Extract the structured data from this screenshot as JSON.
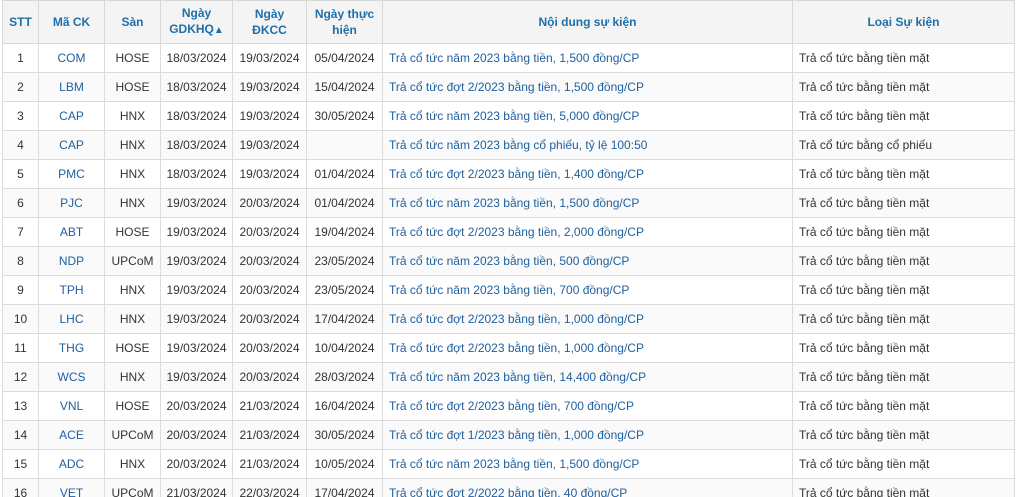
{
  "columns": {
    "stt": "STT",
    "ma_ck": "Mã CK",
    "san": "Sàn",
    "ngay_gdkhq_line1": "Ngày",
    "ngay_gdkhq_line2": "GDKHQ",
    "sort_indicator": "▲",
    "ngay_dkcc_line1": "Ngày",
    "ngay_dkcc_line2": "ĐKCC",
    "ngay_thuc_hien_line1": "Ngày thực",
    "ngay_thuc_hien_line2": "hiện",
    "noi_dung": "Nội dung sự kiện",
    "loai_su_kien": "Loại Sự kiện"
  },
  "rows": [
    {
      "stt": "1",
      "ma_ck": "COM",
      "san": "HOSE",
      "gdkhq": "18/03/2024",
      "dkcc": "19/03/2024",
      "thuc_hien": "05/04/2024",
      "noi_dung": "Trả cổ tức năm 2023 bằng tiền, 1,500 đồng/CP",
      "loai": "Trả cổ tức bằng tiền mặt"
    },
    {
      "stt": "2",
      "ma_ck": "LBM",
      "san": "HOSE",
      "gdkhq": "18/03/2024",
      "dkcc": "19/03/2024",
      "thuc_hien": "15/04/2024",
      "noi_dung": "Trả cổ tức đợt 2/2023 bằng tiền, 1,500 đồng/CP",
      "loai": "Trả cổ tức bằng tiền mặt"
    },
    {
      "stt": "3",
      "ma_ck": "CAP",
      "san": "HNX",
      "gdkhq": "18/03/2024",
      "dkcc": "19/03/2024",
      "thuc_hien": "30/05/2024",
      "noi_dung": "Trả cổ tức năm 2023 bằng tiền, 5,000 đồng/CP",
      "loai": "Trả cổ tức bằng tiền mặt"
    },
    {
      "stt": "4",
      "ma_ck": "CAP",
      "san": "HNX",
      "gdkhq": "18/03/2024",
      "dkcc": "19/03/2024",
      "thuc_hien": "",
      "noi_dung": "Trả cổ tức năm 2023 bằng cổ phiếu, tỷ lệ 100:50",
      "loai": "Trả cổ tức bằng cổ phiếu"
    },
    {
      "stt": "5",
      "ma_ck": "PMC",
      "san": "HNX",
      "gdkhq": "18/03/2024",
      "dkcc": "19/03/2024",
      "thuc_hien": "01/04/2024",
      "noi_dung": "Trả cổ tức đợt 2/2023 bằng tiền, 1,400 đồng/CP",
      "loai": "Trả cổ tức bằng tiền mặt"
    },
    {
      "stt": "6",
      "ma_ck": "PJC",
      "san": "HNX",
      "gdkhq": "19/03/2024",
      "dkcc": "20/03/2024",
      "thuc_hien": "01/04/2024",
      "noi_dung": "Trả cổ tức năm 2023 bằng tiền, 1,500 đồng/CP",
      "loai": "Trả cổ tức bằng tiền mặt"
    },
    {
      "stt": "7",
      "ma_ck": "ABT",
      "san": "HOSE",
      "gdkhq": "19/03/2024",
      "dkcc": "20/03/2024",
      "thuc_hien": "19/04/2024",
      "noi_dung": "Trả cổ tức đợt 2/2023 bằng tiền, 2,000 đồng/CP",
      "loai": "Trả cổ tức bằng tiền mặt"
    },
    {
      "stt": "8",
      "ma_ck": "NDP",
      "san": "UPCoM",
      "gdkhq": "19/03/2024",
      "dkcc": "20/03/2024",
      "thuc_hien": "23/05/2024",
      "noi_dung": "Trả cổ tức năm 2023 bằng tiền, 500 đồng/CP",
      "loai": "Trả cổ tức bằng tiền mặt"
    },
    {
      "stt": "9",
      "ma_ck": "TPH",
      "san": "HNX",
      "gdkhq": "19/03/2024",
      "dkcc": "20/03/2024",
      "thuc_hien": "23/05/2024",
      "noi_dung": "Trả cổ tức năm 2023 bằng tiền, 700 đồng/CP",
      "loai": "Trả cổ tức bằng tiền mặt"
    },
    {
      "stt": "10",
      "ma_ck": "LHC",
      "san": "HNX",
      "gdkhq": "19/03/2024",
      "dkcc": "20/03/2024",
      "thuc_hien": "17/04/2024",
      "noi_dung": "Trả cổ tức đợt 2/2023 bằng tiền, 1,000 đồng/CP",
      "loai": "Trả cổ tức bằng tiền mặt"
    },
    {
      "stt": "11",
      "ma_ck": "THG",
      "san": "HOSE",
      "gdkhq": "19/03/2024",
      "dkcc": "20/03/2024",
      "thuc_hien": "10/04/2024",
      "noi_dung": "Trả cổ tức đợt 2/2023 bằng tiền, 1,000 đồng/CP",
      "loai": "Trả cổ tức bằng tiền mặt"
    },
    {
      "stt": "12",
      "ma_ck": "WCS",
      "san": "HNX",
      "gdkhq": "19/03/2024",
      "dkcc": "20/03/2024",
      "thuc_hien": "28/03/2024",
      "noi_dung": "Trả cổ tức năm 2023 bằng tiền, 14,400 đồng/CP",
      "loai": "Trả cổ tức bằng tiền mặt"
    },
    {
      "stt": "13",
      "ma_ck": "VNL",
      "san": "HOSE",
      "gdkhq": "20/03/2024",
      "dkcc": "21/03/2024",
      "thuc_hien": "16/04/2024",
      "noi_dung": "Trả cổ tức đợt 2/2023 bằng tiền, 700 đồng/CP",
      "loai": "Trả cổ tức bằng tiền mặt"
    },
    {
      "stt": "14",
      "ma_ck": "ACE",
      "san": "UPCoM",
      "gdkhq": "20/03/2024",
      "dkcc": "21/03/2024",
      "thuc_hien": "30/05/2024",
      "noi_dung": "Trả cổ tức đợt 1/2023 bằng tiền, 1,000 đồng/CP",
      "loai": "Trả cổ tức bằng tiền mặt"
    },
    {
      "stt": "15",
      "ma_ck": "ADC",
      "san": "HNX",
      "gdkhq": "20/03/2024",
      "dkcc": "21/03/2024",
      "thuc_hien": "10/05/2024",
      "noi_dung": "Trả cổ tức năm 2023 bằng tiền, 1,500 đồng/CP",
      "loai": "Trả cổ tức bằng tiền mặt"
    },
    {
      "stt": "16",
      "ma_ck": "VET",
      "san": "UPCoM",
      "gdkhq": "21/03/2024",
      "dkcc": "22/03/2024",
      "thuc_hien": "17/04/2024",
      "noi_dung": "Trả cổ tức đợt 2/2022 bằng tiền, 40 đồng/CP",
      "loai": "Trả cổ tức bằng tiền mặt"
    }
  ],
  "colors": {
    "header_text": "#1f6fa8",
    "link_text": "#1e5f9e",
    "header_bg": "#f4f4f4",
    "border": "#dcdcdc"
  }
}
